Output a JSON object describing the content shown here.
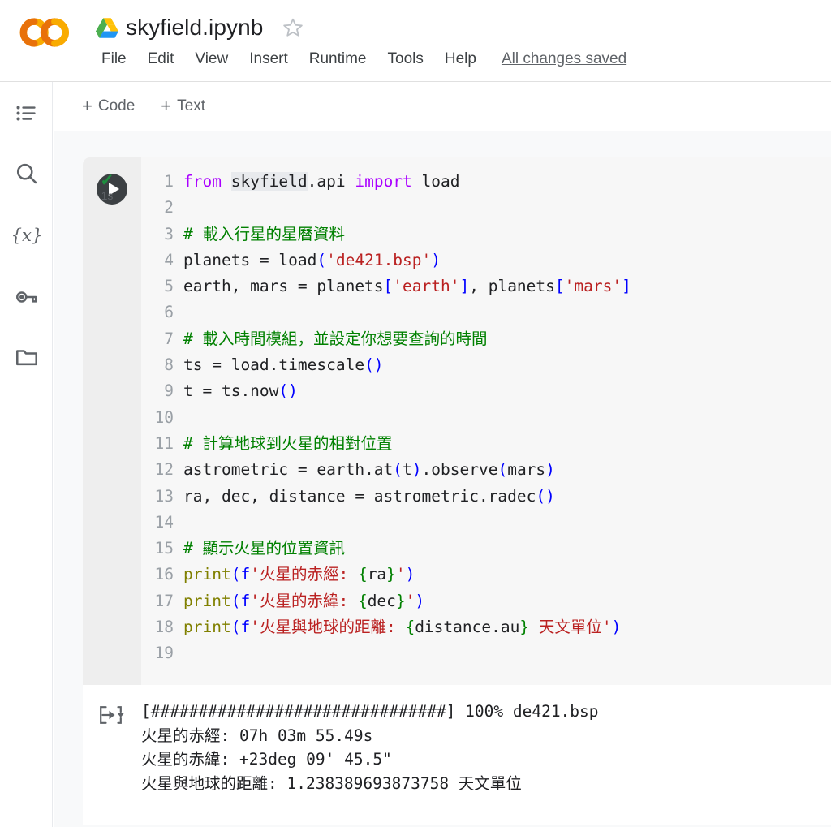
{
  "header": {
    "doc_title": "skyfield.ipynb",
    "drive_icon": "google-drive-icon",
    "star_icon": "star-outline-icon",
    "logo": "colab-logo",
    "menu": [
      {
        "label": "File"
      },
      {
        "label": "Edit"
      },
      {
        "label": "View"
      },
      {
        "label": "Insert"
      },
      {
        "label": "Runtime"
      },
      {
        "label": "Tools"
      },
      {
        "label": "Help"
      }
    ],
    "save_status": "All changes saved"
  },
  "sidebar": {
    "items": [
      {
        "icon": "table-of-contents-icon",
        "name": "table-of-contents"
      },
      {
        "icon": "search-icon",
        "name": "find-and-replace"
      },
      {
        "icon": "variables-icon",
        "name": "variables"
      },
      {
        "icon": "key-icon",
        "name": "secrets"
      },
      {
        "icon": "folder-icon",
        "name": "files"
      }
    ]
  },
  "toolbar": {
    "add_code_label": "Code",
    "add_text_label": "Text",
    "plus_glyph": "+"
  },
  "cell": {
    "run_icon": "play-icon",
    "exec_check": "✓",
    "exec_time": "1s",
    "lines": [
      {
        "n": "1",
        "tokens": [
          {
            "c": "t-kw",
            "t": "from"
          },
          {
            "c": "t-plain",
            "t": " "
          },
          {
            "c": "t-mod",
            "t": "skyfield"
          },
          {
            "c": "t-plain",
            "t": ".api "
          },
          {
            "c": "t-kw",
            "t": "import"
          },
          {
            "c": "t-plain",
            "t": " load"
          }
        ]
      },
      {
        "n": "2",
        "tokens": []
      },
      {
        "n": "3",
        "tokens": [
          {
            "c": "t-com",
            "t": "# 載入行星的星曆資料"
          }
        ]
      },
      {
        "n": "4",
        "tokens": [
          {
            "c": "t-plain",
            "t": "planets = load"
          },
          {
            "c": "t-brk",
            "t": "("
          },
          {
            "c": "t-str",
            "t": "'de421.bsp'"
          },
          {
            "c": "t-brk",
            "t": ")"
          }
        ]
      },
      {
        "n": "5",
        "tokens": [
          {
            "c": "t-plain",
            "t": "earth, mars = planets"
          },
          {
            "c": "t-brk",
            "t": "["
          },
          {
            "c": "t-str",
            "t": "'earth'"
          },
          {
            "c": "t-brk",
            "t": "]"
          },
          {
            "c": "t-plain",
            "t": ", planets"
          },
          {
            "c": "t-brk",
            "t": "["
          },
          {
            "c": "t-str",
            "t": "'mars'"
          },
          {
            "c": "t-brk",
            "t": "]"
          }
        ]
      },
      {
        "n": "6",
        "tokens": []
      },
      {
        "n": "7",
        "tokens": [
          {
            "c": "t-com",
            "t": "# 載入時間模組，並設定你想要查詢的時間"
          }
        ]
      },
      {
        "n": "8",
        "tokens": [
          {
            "c": "t-plain",
            "t": "ts = load.timescale"
          },
          {
            "c": "t-brk",
            "t": "()"
          }
        ]
      },
      {
        "n": "9",
        "tokens": [
          {
            "c": "t-plain",
            "t": "t = ts.now"
          },
          {
            "c": "t-brk",
            "t": "()"
          }
        ]
      },
      {
        "n": "10",
        "tokens": []
      },
      {
        "n": "11",
        "tokens": [
          {
            "c": "t-com",
            "t": "# 計算地球到火星的相對位置"
          }
        ]
      },
      {
        "n": "12",
        "tokens": [
          {
            "c": "t-plain",
            "t": "astrometric = earth.at"
          },
          {
            "c": "t-brk",
            "t": "("
          },
          {
            "c": "t-plain",
            "t": "t"
          },
          {
            "c": "t-brk",
            "t": ")"
          },
          {
            "c": "t-plain",
            "t": ".observe"
          },
          {
            "c": "t-brk",
            "t": "("
          },
          {
            "c": "t-plain",
            "t": "mars"
          },
          {
            "c": "t-brk",
            "t": ")"
          }
        ]
      },
      {
        "n": "13",
        "tokens": [
          {
            "c": "t-plain",
            "t": "ra, dec, distance = astrometric.radec"
          },
          {
            "c": "t-brk",
            "t": "()"
          }
        ]
      },
      {
        "n": "14",
        "tokens": []
      },
      {
        "n": "15",
        "tokens": [
          {
            "c": "t-com",
            "t": "# 顯示火星的位置資訊"
          }
        ]
      },
      {
        "n": "16",
        "tokens": [
          {
            "c": "t-fn",
            "t": "print"
          },
          {
            "c": "t-brk",
            "t": "("
          },
          {
            "c": "t-fpre",
            "t": "f"
          },
          {
            "c": "t-str",
            "t": "'火星的赤經: "
          },
          {
            "c": "t-brace",
            "t": "{"
          },
          {
            "c": "t-plain",
            "t": "ra"
          },
          {
            "c": "t-brace",
            "t": "}"
          },
          {
            "c": "t-str",
            "t": "'"
          },
          {
            "c": "t-brk",
            "t": ")"
          }
        ]
      },
      {
        "n": "17",
        "tokens": [
          {
            "c": "t-fn",
            "t": "print"
          },
          {
            "c": "t-brk",
            "t": "("
          },
          {
            "c": "t-fpre",
            "t": "f"
          },
          {
            "c": "t-str",
            "t": "'火星的赤緯: "
          },
          {
            "c": "t-brace",
            "t": "{"
          },
          {
            "c": "t-plain",
            "t": "dec"
          },
          {
            "c": "t-brace",
            "t": "}"
          },
          {
            "c": "t-str",
            "t": "'"
          },
          {
            "c": "t-brk",
            "t": ")"
          }
        ]
      },
      {
        "n": "18",
        "tokens": [
          {
            "c": "t-fn",
            "t": "print"
          },
          {
            "c": "t-brk",
            "t": "("
          },
          {
            "c": "t-fpre",
            "t": "f"
          },
          {
            "c": "t-str",
            "t": "'火星與地球的距離: "
          },
          {
            "c": "t-brace",
            "t": "{"
          },
          {
            "c": "t-plain",
            "t": "distance.au"
          },
          {
            "c": "t-brace",
            "t": "}"
          },
          {
            "c": "t-str",
            "t": " 天文單位'"
          },
          {
            "c": "t-brk",
            "t": ")"
          }
        ]
      },
      {
        "n": "19",
        "tokens": []
      }
    ]
  },
  "output": {
    "icon": "output-options-icon",
    "lines": [
      "[###############################] 100% de421.bsp",
      "火星的赤經: 07h 03m 55.49s",
      "火星的赤緯: +23deg 09' 45.5\"",
      "火星與地球的距離: 1.238389693873758 天文單位"
    ]
  },
  "colors": {
    "keyword": "#aa00ff",
    "string": "#ba2121",
    "comment": "#008000",
    "bracket": "#0000ff",
    "function": "#808000",
    "success": "#1e8e3e",
    "code_bg": "#f7f7f7",
    "canvas_bg": "#f8f9fa"
  }
}
